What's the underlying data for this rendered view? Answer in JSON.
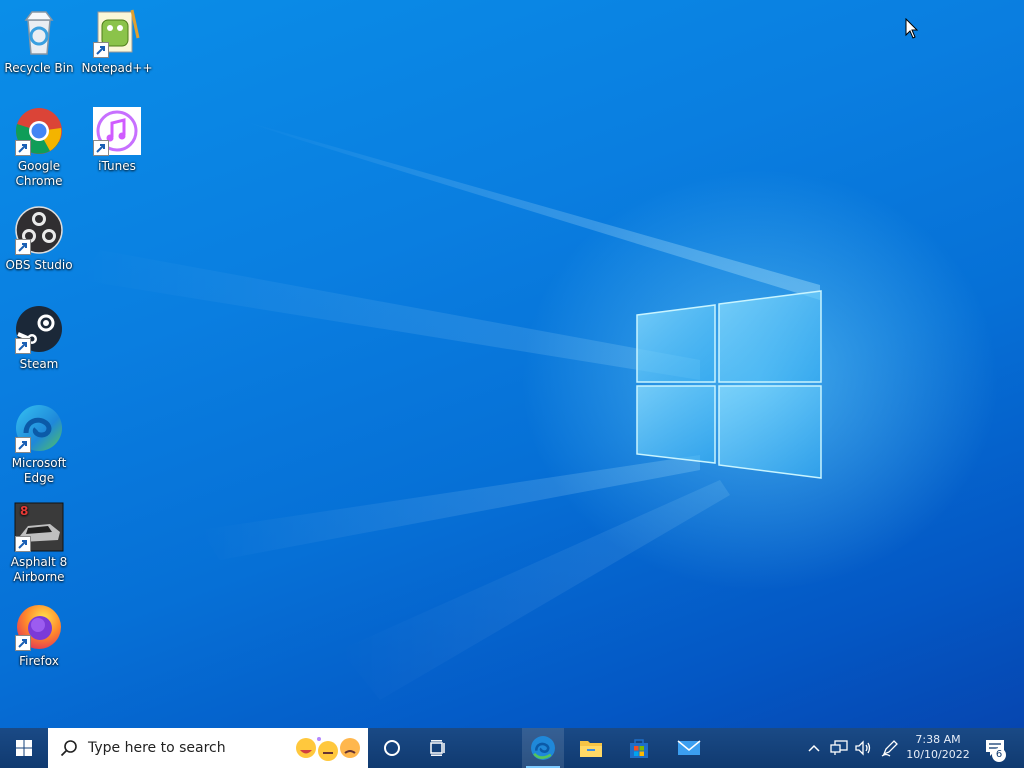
{
  "desktop": {
    "icons": [
      {
        "label": "Recycle Bin",
        "icon": "recycle-bin-icon"
      },
      {
        "label": "Notepad++",
        "icon": "notepad-plus-plus-icon"
      },
      {
        "label": "Google Chrome",
        "icon": "chrome-icon"
      },
      {
        "label": "iTunes",
        "icon": "itunes-icon"
      },
      {
        "label": "OBS Studio",
        "icon": "obs-icon"
      },
      {
        "label": "Steam",
        "icon": "steam-icon"
      },
      {
        "label": "Microsoft Edge",
        "icon": "edge-icon"
      },
      {
        "label": "Asphalt 8 Airborne",
        "icon": "asphalt-icon"
      },
      {
        "label": "Firefox",
        "icon": "firefox-icon"
      }
    ]
  },
  "taskbar": {
    "start": "windows-start-icon",
    "search": {
      "placeholder": "Type here to search"
    },
    "pinned": [
      "edge-icon",
      "file-explorer-icon",
      "microsoft-store-icon",
      "mail-icon"
    ],
    "clock": {
      "time": "7:38 AM",
      "date": "10/10/2022"
    },
    "notifications": {
      "count": "6"
    }
  },
  "colors": {
    "taskbar": "#103a70",
    "desktop": "#0a7ee0",
    "accent": "#7ecbff"
  }
}
